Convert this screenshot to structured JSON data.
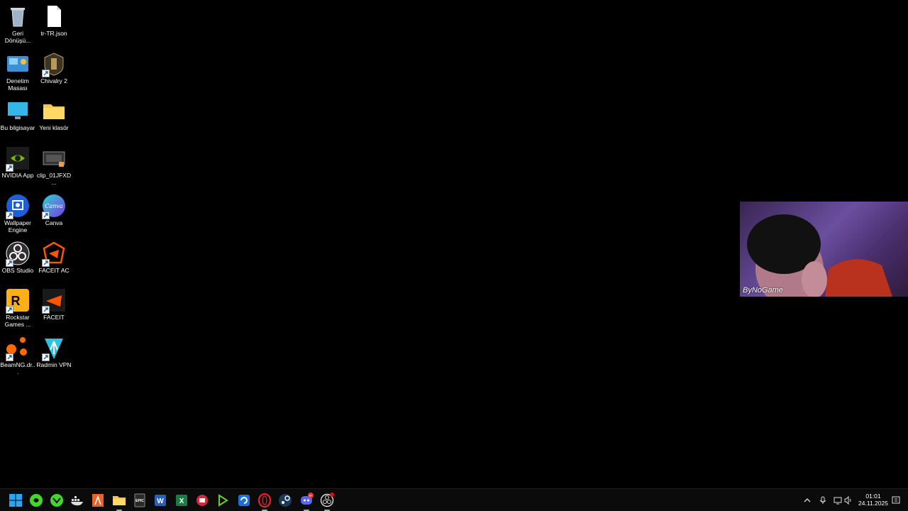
{
  "desktop": {
    "icons": [
      {
        "label": "Geri Dönüşü...",
        "icon": "recycle-bin-icon"
      },
      {
        "label": "tr-TR.json",
        "icon": "file-icon"
      },
      {
        "label": "Denetim Masası",
        "icon": "control-panel-icon"
      },
      {
        "label": "Chivalry 2",
        "icon": "chivalry-icon"
      },
      {
        "label": "Bu bilgisayar",
        "icon": "computer-icon"
      },
      {
        "label": "Yeni klasör",
        "icon": "folder-icon"
      },
      {
        "label": "NVIDIA App",
        "icon": "nvidia-icon"
      },
      {
        "label": "clip_01JFXD...",
        "icon": "video-file-icon"
      },
      {
        "label": "Wallpaper Engine",
        "icon": "wallpaper-engine-icon"
      },
      {
        "label": "Canva",
        "icon": "canva-icon"
      },
      {
        "label": "OBS Studio",
        "icon": "obs-icon"
      },
      {
        "label": "FACEIT AC",
        "icon": "faceit-ac-icon"
      },
      {
        "label": "Rockstar Games ...",
        "icon": "rockstar-icon"
      },
      {
        "label": "FACEIT",
        "icon": "faceit-icon"
      },
      {
        "label": "BeamNG.dr...",
        "icon": "beamng-icon"
      },
      {
        "label": "Radmin VPN",
        "icon": "radmin-icon"
      }
    ],
    "canva_text": "Canva"
  },
  "webcam": {
    "overlay_label": "ByNoGame"
  },
  "taskbar": {
    "apps": [
      {
        "name": "start",
        "icon": "windows-icon"
      },
      {
        "name": "razer-1",
        "icon": "razer-icon"
      },
      {
        "name": "razer-2",
        "icon": "razer-synapse-icon"
      },
      {
        "name": "docker",
        "icon": "docker-icon"
      },
      {
        "name": "tool",
        "icon": "orange-app-icon"
      },
      {
        "name": "explorer",
        "icon": "folder-icon"
      },
      {
        "name": "epic",
        "icon": "epic-games-icon"
      },
      {
        "name": "word",
        "icon": "word-icon"
      },
      {
        "name": "excel",
        "icon": "excel-icon"
      },
      {
        "name": "red-app",
        "icon": "red-app-icon"
      },
      {
        "name": "play",
        "icon": "play-icon"
      },
      {
        "name": "blue-app",
        "icon": "blue-app-icon"
      },
      {
        "name": "opera",
        "icon": "opera-icon"
      },
      {
        "name": "steam",
        "icon": "steam-icon"
      },
      {
        "name": "discord",
        "icon": "discord-icon"
      },
      {
        "name": "obs",
        "icon": "obs-icon"
      }
    ],
    "epic_text": "EPIC",
    "word_letter": "W",
    "excel_letter": "X",
    "discord_badge": "9+",
    "clock": {
      "time": "01:01",
      "date": "24.11.2025"
    }
  }
}
